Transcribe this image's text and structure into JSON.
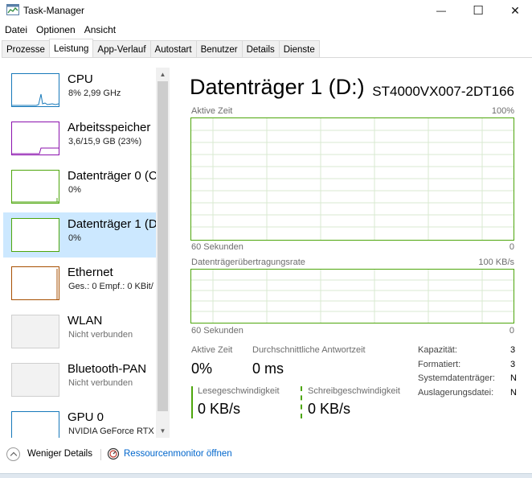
{
  "window": {
    "title": "Task-Manager",
    "minimize_glyph": "—",
    "maximize_glyph": "☐",
    "close_glyph": "✕"
  },
  "menu": [
    "Datei",
    "Optionen",
    "Ansicht"
  ],
  "tabs": [
    "Prozesse",
    "Leistung",
    "App-Verlauf",
    "Autostart",
    "Benutzer",
    "Details",
    "Dienste"
  ],
  "active_tab": "Leistung",
  "sidebar": {
    "items": [
      {
        "name": "CPU",
        "sub": "8%  2,99 GHz",
        "color": "#1779ba",
        "icon": "cpu-graph-icon"
      },
      {
        "name": "Arbeitsspeicher",
        "sub": "3,6/15,9 GB (23%)",
        "color": "#8b12ae",
        "icon": "memory-graph-icon"
      },
      {
        "name": "Datenträger 0 (C",
        "sub": "0%",
        "color": "#4da60c",
        "icon": "disk-graph-icon"
      },
      {
        "name": "Datenträger 1 (D",
        "sub": "0%",
        "color": "#4da60c",
        "icon": "disk-graph-icon"
      },
      {
        "name": "Ethernet",
        "sub": "Ges.: 0  Empf.: 0 KBit/",
        "color": "#a74f01",
        "icon": "ethernet-graph-icon"
      },
      {
        "name": "WLAN",
        "sub": "Nicht verbunden",
        "color": "#bcbcbc",
        "icon": "wlan-graph-icon"
      },
      {
        "name": "Bluetooth-PAN",
        "sub": "Nicht verbunden",
        "color": "#bcbcbc",
        "icon": "bluetooth-graph-icon"
      },
      {
        "name": "GPU 0",
        "sub": "NVIDIA GeForce RTX",
        "color": "#1779ba",
        "icon": "gpu-graph-icon"
      }
    ],
    "selected_index": 3,
    "scroll_up_glyph": "▲",
    "scroll_down_glyph": "▼"
  },
  "detail": {
    "title": "Datenträger 1 (D:)",
    "model": "ST4000VX007-2DT166",
    "graph1": {
      "label_left": "Aktive Zeit",
      "label_right": "100%",
      "bottom_left": "60 Sekunden",
      "bottom_right": "0"
    },
    "graph2": {
      "label_left": "Datenträgerübertragungsrate",
      "label_right": "100 KB/s",
      "bottom_left": "60 Sekunden",
      "bottom_right": "0"
    },
    "stats": {
      "active_time_label": "Aktive Zeit",
      "active_time_value": "0%",
      "response_label": "Durchschnittliche Antwortzeit",
      "response_value": "0 ms",
      "read_label": "Lesegeschwindigkeit",
      "read_value": "0 KB/s",
      "write_label": "Schreibgeschwindigkeit",
      "write_value": "0 KB/s"
    },
    "info": [
      {
        "label": "Kapazität:",
        "value": "3"
      },
      {
        "label": "Formatiert:",
        "value": "3"
      },
      {
        "label": "Systemdatenträger:",
        "value": "N"
      },
      {
        "label": "Auslagerungsdatei:",
        "value": "N"
      }
    ],
    "accent_color": "#4da60c"
  },
  "footer": {
    "fewer_details": "Weniger Details",
    "resource_monitor": "Ressourcenmonitor öffnen"
  }
}
